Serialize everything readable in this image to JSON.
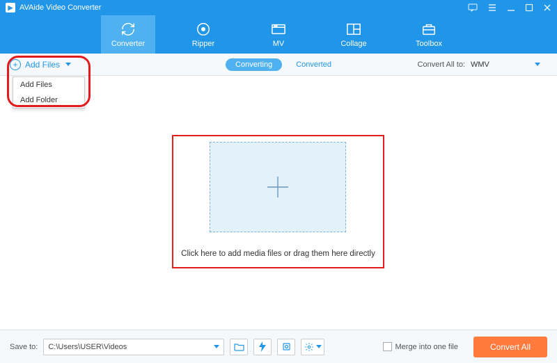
{
  "titlebar": {
    "app_name": "AVAide Video Converter"
  },
  "tabs": {
    "converter": "Converter",
    "ripper": "Ripper",
    "mv": "MV",
    "collage": "Collage",
    "toolbox": "Toolbox"
  },
  "subbar": {
    "add_files": "Add Files",
    "converting": "Converting",
    "converted": "Converted",
    "convert_all_to": "Convert All to:",
    "format_selected": "WMV"
  },
  "dropdown": {
    "add_files": "Add Files",
    "add_folder": "Add Folder"
  },
  "dropzone": {
    "hint": "Click here to add media files or drag them here directly"
  },
  "footer": {
    "save_to": "Save to:",
    "path": "C:\\Users\\USER\\Videos",
    "merge": "Merge into one file",
    "convert_all": "Convert All"
  },
  "icons": {
    "feedback": "feedback-icon",
    "menu": "menu-icon",
    "minimize": "minimize-icon",
    "maximize": "maximize-icon",
    "close": "close-icon",
    "folder": "folder-icon",
    "flash": "flash-icon",
    "gpu": "gpu-icon",
    "settings": "settings-icon"
  }
}
